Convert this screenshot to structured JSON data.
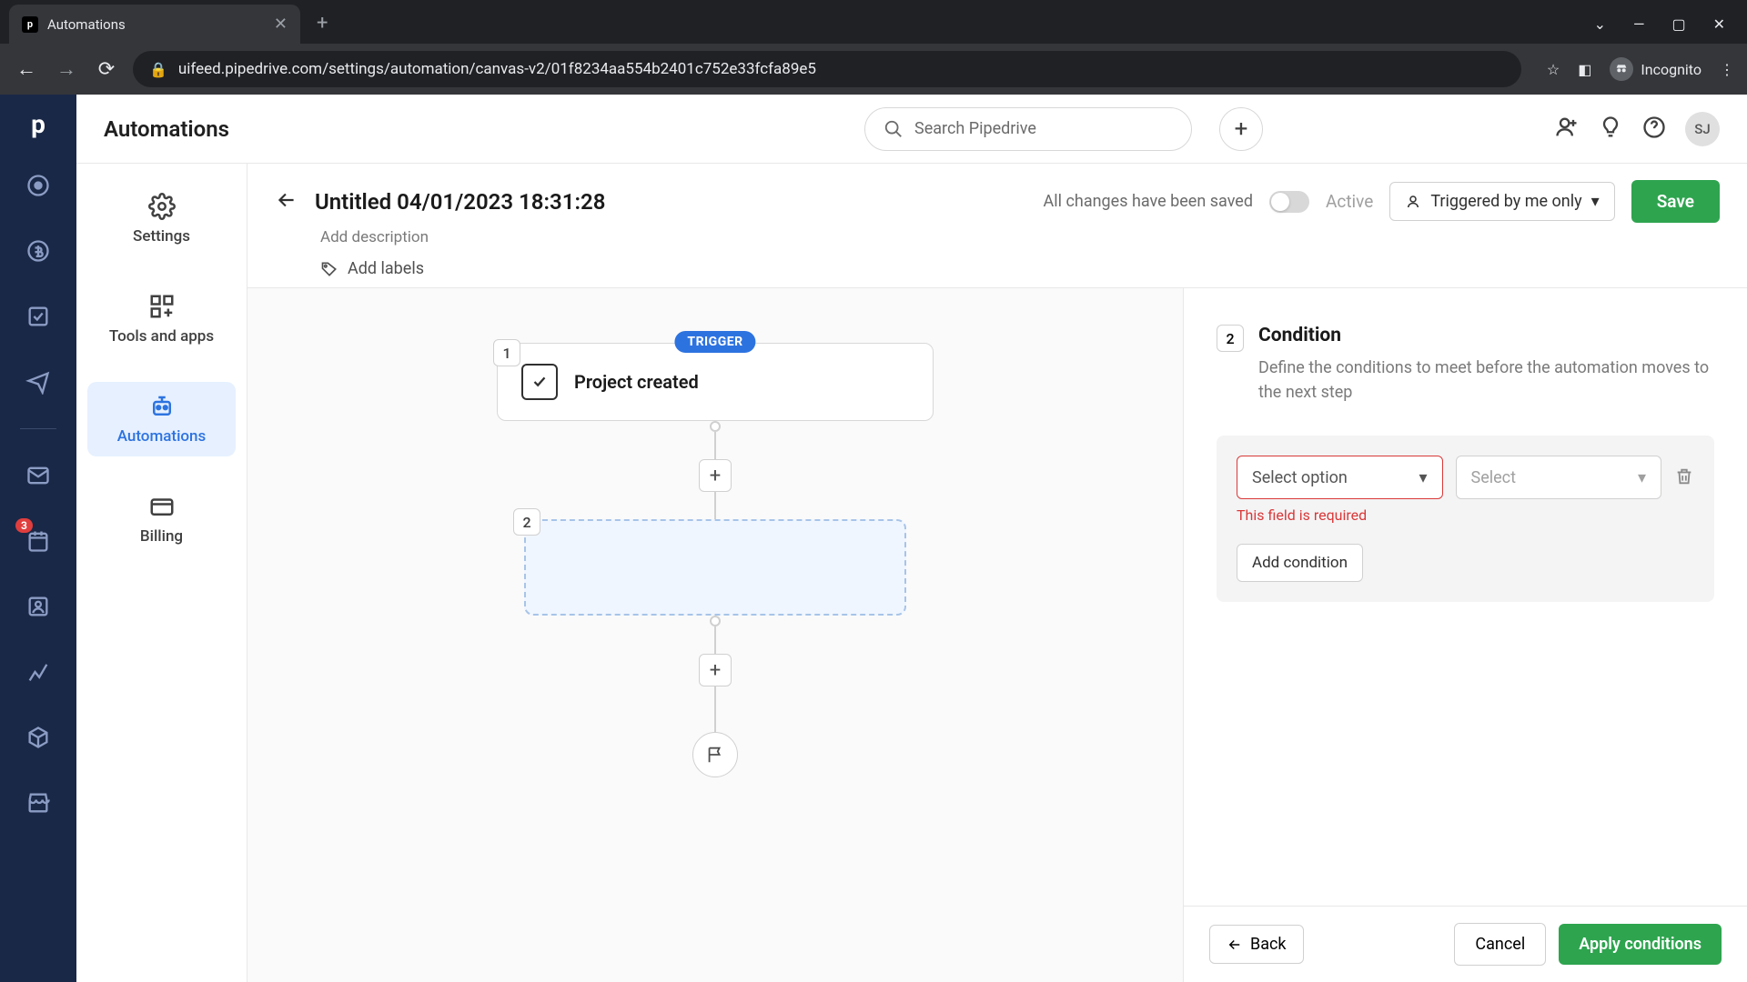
{
  "browser": {
    "tab_title": "Automations",
    "url": "uifeed.pipedrive.com/settings/automation/canvas-v2/01f8234aa554b2401c752e33fcfa89e5",
    "incognito_label": "Incognito"
  },
  "topbar": {
    "title": "Automations",
    "search_placeholder": "Search Pipedrive",
    "avatar_initials": "SJ"
  },
  "rail": {
    "badge_count": "3"
  },
  "secnav": {
    "items": [
      {
        "label": "Settings"
      },
      {
        "label": "Tools and apps"
      },
      {
        "label": "Automations"
      },
      {
        "label": "Billing"
      }
    ]
  },
  "header": {
    "title": "Untitled 04/01/2023 18:31:28",
    "add_description": "Add description",
    "add_labels": "Add labels",
    "saved_text": "All changes have been saved",
    "active_label": "Active",
    "trigger_scope": "Triggered by me only",
    "save_label": "Save"
  },
  "canvas": {
    "step1_num": "1",
    "trigger_badge": "TRIGGER",
    "node1_title": "Project created",
    "step2_num": "2"
  },
  "panel": {
    "step_num": "2",
    "title": "Condition",
    "description": "Define the conditions to meet before the automation moves to the next step",
    "dd1_placeholder": "Select option",
    "dd2_placeholder": "Select",
    "error_text": "This field is required",
    "add_condition_label": "Add condition",
    "back_label": "Back",
    "cancel_label": "Cancel",
    "apply_label": "Apply conditions"
  }
}
